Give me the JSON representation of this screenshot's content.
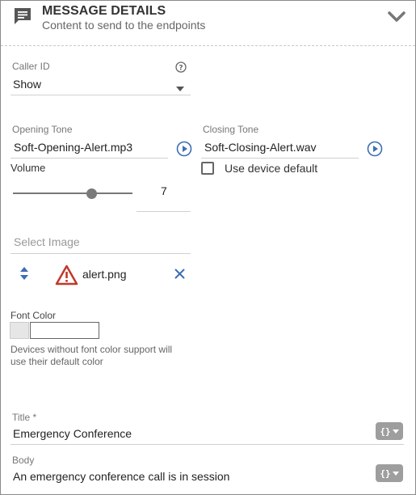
{
  "header": {
    "title": "MESSAGE DETAILS",
    "subtitle": "Content to send to the endpoints",
    "icon": "message-icon",
    "collapse_icon": "chevron-down-icon"
  },
  "caller_id": {
    "label": "Caller ID",
    "value": "Show",
    "help_icon": "help-icon"
  },
  "opening_tone": {
    "label": "Opening Tone",
    "value": "Soft-Opening-Alert.mp3",
    "play_icon": "play-icon"
  },
  "closing_tone": {
    "label": "Closing Tone",
    "value": "Soft-Closing-Alert.wav",
    "play_icon": "play-icon"
  },
  "volume": {
    "label": "Volume",
    "value": "7",
    "level_fraction": 0.7
  },
  "use_device_default": {
    "label": "Use device default",
    "checked": false
  },
  "image": {
    "placeholder": "Select Image",
    "file_name": "alert.png",
    "file_icon": "warning-icon",
    "sort_icon": "sort-icon",
    "remove_icon": "close-icon"
  },
  "font_color": {
    "label": "Font Color",
    "value": "",
    "note": "Devices without font color support will use their default color"
  },
  "title_field": {
    "label": "Title *",
    "value": "Emergency Conference",
    "template_icon": "braces-icon"
  },
  "body_field": {
    "label": "Body",
    "value": "An emergency conference call is in session",
    "template_icon": "braces-icon"
  },
  "colors": {
    "accent_blue": "#3d6eb3",
    "warning_red": "#c0392b",
    "text": "#333333"
  }
}
